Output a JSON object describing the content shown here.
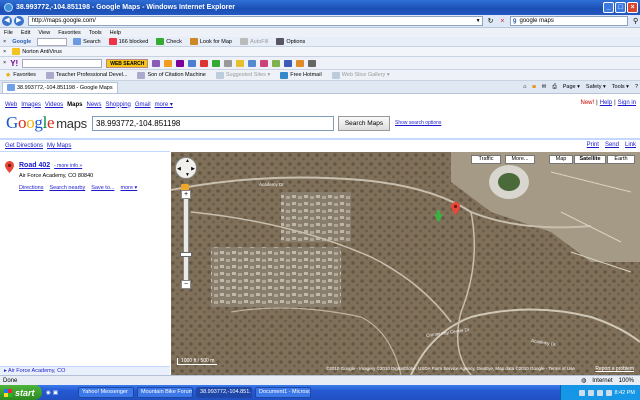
{
  "window": {
    "title": "38.993772,-104.851198 - Google Maps - Windows Internet Explorer",
    "controls": [
      "_",
      "□",
      "×"
    ]
  },
  "address": {
    "url": "http://maps.google.com/",
    "search_placeholder": "google maps",
    "search_value": "google maps"
  },
  "menu": [
    "File",
    "Edit",
    "View",
    "Favorites",
    "Tools",
    "Help"
  ],
  "toolbar1": {
    "google_label": "Google",
    "search": "Search",
    "blocked": "166 blocked",
    "check": "Check",
    "lookfor": "Look for Map",
    "autofill": "AutoFill",
    "options": "Options"
  },
  "toolbar2": {
    "norton": "Norton AntiVirus"
  },
  "toolbar3": {
    "yahoo": "Y!",
    "websearch": "WEB SEARCH"
  },
  "favorites": {
    "label": "Favorites",
    "items": [
      "Teacher Professional Devel...",
      "Son of Citation Machine",
      "Suggested Sites ▾",
      "Free Hotmail",
      "Web Slice Gallery ▾"
    ]
  },
  "tab": {
    "title": "38.993772,-104.851198 - Google Maps",
    "tools": [
      "Page ▾",
      "Safety ▾",
      "Tools ▾"
    ]
  },
  "gnav": {
    "items": [
      "Web",
      "Images",
      "Videos",
      "Maps",
      "News",
      "Shopping",
      "Gmail",
      "more ▾"
    ],
    "selected": "Maps"
  },
  "gright": {
    "new": "New!",
    "help": "Help",
    "signin": "Sign in"
  },
  "logo": {
    "google": "Google",
    "maps": "maps"
  },
  "search": {
    "query": "38.993772,-104.851198",
    "button": "Search Maps",
    "options": "Show search options"
  },
  "left_header": {
    "directions": "Get Directions",
    "mymaps": "My Maps"
  },
  "right_header": {
    "print": "Print",
    "send": "Send",
    "link": "Link"
  },
  "result": {
    "title": "Road 402",
    "more_info": "- more info »",
    "address": "Air Force Academy, CO 80840",
    "links": [
      "Directions",
      "Search nearby",
      "Save to...",
      "more ▾"
    ]
  },
  "left_footer": "Air Force Academy, CO",
  "map": {
    "types": [
      "Traffic",
      "More...",
      "Map",
      "Satellite",
      "Earth"
    ],
    "selected_type": "Satellite",
    "scale": "1000 ft / 500 m",
    "copyright": "©2010 Google - Imagery ©2010 DigitalGlobe, USDA Farm Service Agency, GeoEye, Map data ©2010 Google - Terms of Use",
    "report": "Report a problem",
    "labels": [
      "Academy Dr",
      "Community Center Dr",
      "Academy Dr"
    ]
  },
  "status": {
    "left": "Done",
    "zone": "Internet",
    "zoom": "100%"
  },
  "taskbar": {
    "start": "start",
    "tasks": [
      "Yahoo! Messenger",
      "Mountain Bike Forum...",
      "38.993772,-104.851...",
      "Document1 - Microsof..."
    ],
    "clock": "8:42 PM"
  }
}
